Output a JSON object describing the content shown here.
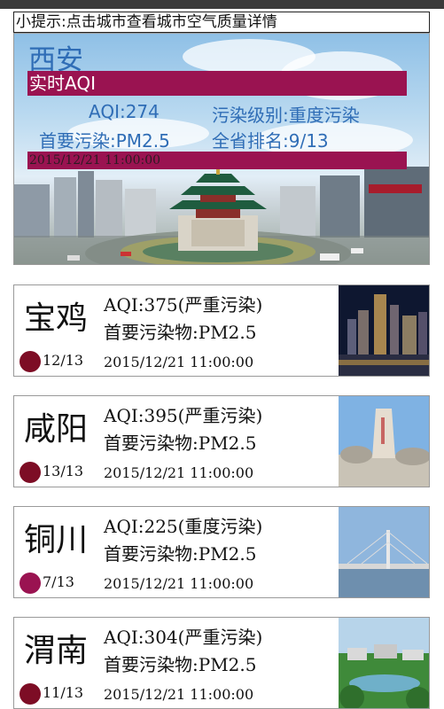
{
  "hint": "小提示:点击城市查看城市空气质量详情",
  "hero": {
    "city": "西安",
    "realtime_label": "实时AQI",
    "aqi": "AQI:274",
    "level": "污染级别:重度污染",
    "primary": "首要污染:PM2.5",
    "rank": "全省排名:9/13",
    "time": "2015/12/21 11:00:00"
  },
  "cards": [
    {
      "city": "宝鸡",
      "aqi": "AQI:375(严重污染)",
      "primary": "首要污染物:PM2.5",
      "rank": "12/13",
      "time": "2015/12/21 11:00:00",
      "dot_color": "#7d0d25"
    },
    {
      "city": "咸阳",
      "aqi": "AQI:395(严重污染)",
      "primary": "首要污染物:PM2.5",
      "rank": "13/13",
      "time": "2015/12/21 11:00:00",
      "dot_color": "#7d0d25"
    },
    {
      "city": "铜川",
      "aqi": "AQI:225(重度污染)",
      "primary": "首要污染物:PM2.5",
      "rank": "7/13",
      "time": "2015/12/21 11:00:00",
      "dot_color": "#9a1351"
    },
    {
      "city": "渭南",
      "aqi": "AQI:304(严重污染)",
      "primary": "首要污染物:PM2.5",
      "rank": "11/13",
      "time": "2015/12/21 11:00:00",
      "dot_color": "#7d0d25"
    }
  ],
  "colors": {
    "title_blue": "#2f6db6",
    "band": "#9a1351",
    "severe": "#7d0d25",
    "heavy": "#9a1351"
  }
}
